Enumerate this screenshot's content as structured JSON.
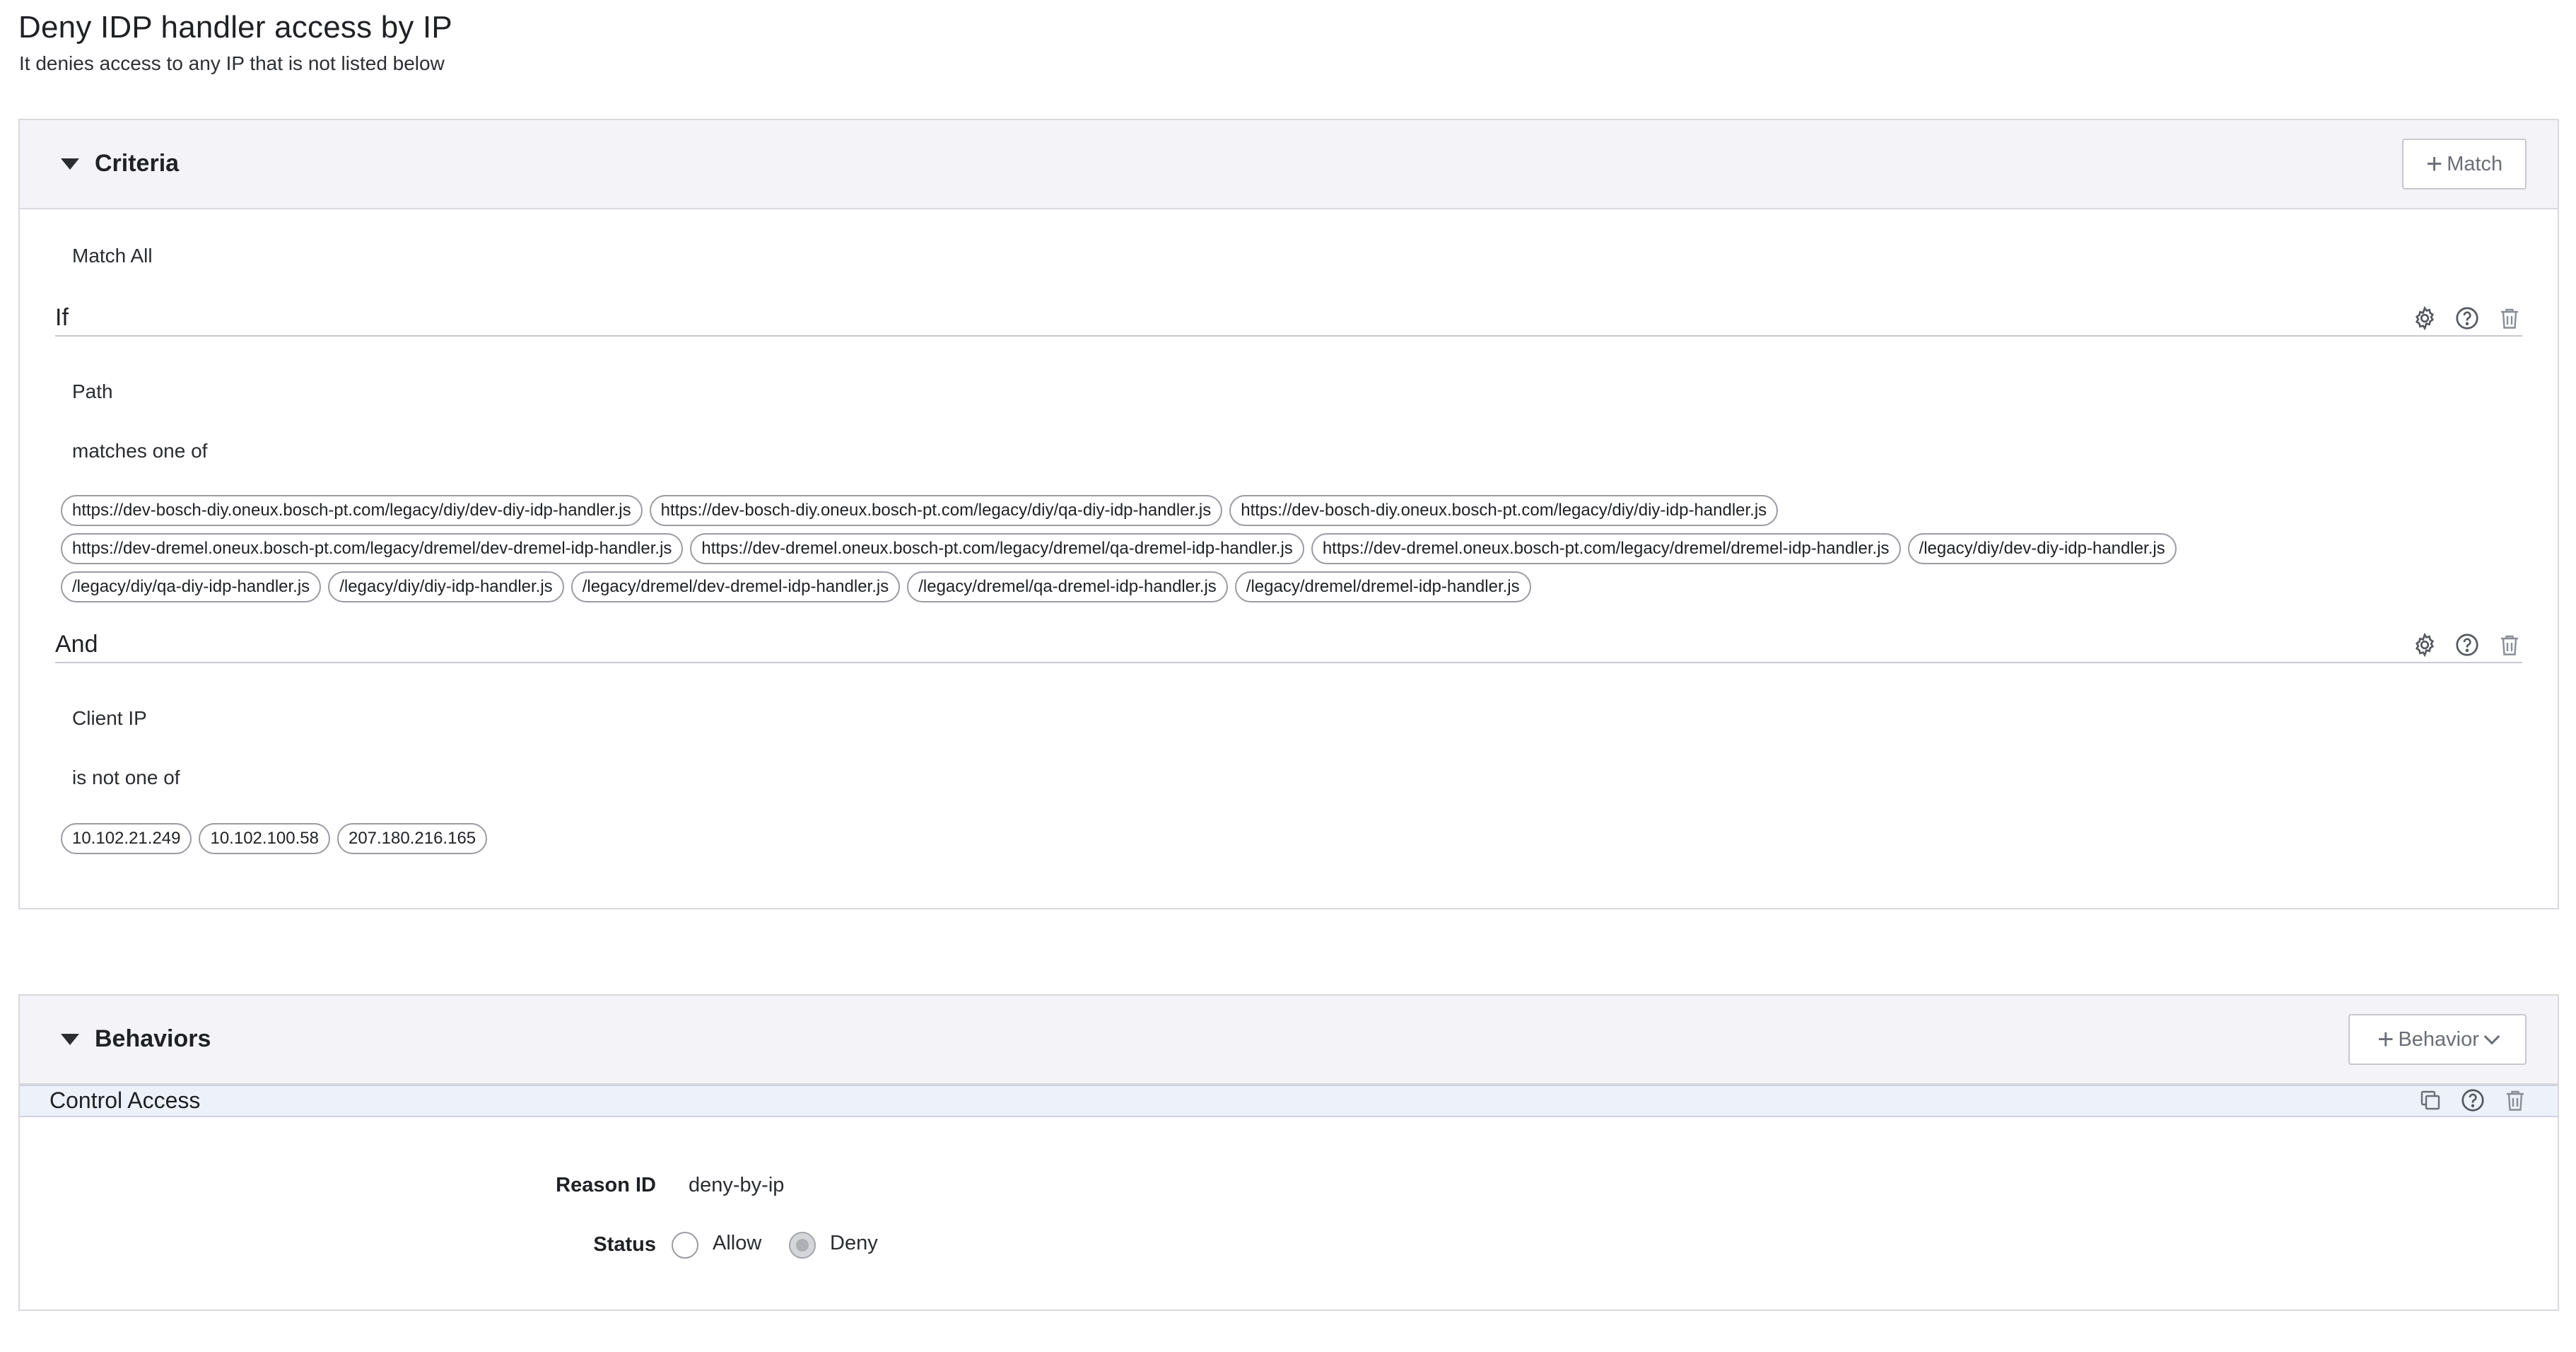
{
  "page": {
    "title": "Deny IDP handler access by IP",
    "subtitle": "It denies access to any IP that is not listed below"
  },
  "criteria": {
    "title": "Criteria",
    "add_button": "Match",
    "match_mode": "Match All",
    "conditions": [
      {
        "connector": "If",
        "field": "Path",
        "operator": "matches one of",
        "values": [
          "https://dev-bosch-diy.oneux.bosch-pt.com/legacy/diy/dev-diy-idp-handler.js",
          "https://dev-bosch-diy.oneux.bosch-pt.com/legacy/diy/qa-diy-idp-handler.js",
          "https://dev-bosch-diy.oneux.bosch-pt.com/legacy/diy/diy-idp-handler.js",
          "https://dev-dremel.oneux.bosch-pt.com/legacy/dremel/dev-dremel-idp-handler.js",
          "https://dev-dremel.oneux.bosch-pt.com/legacy/dremel/qa-dremel-idp-handler.js",
          "https://dev-dremel.oneux.bosch-pt.com/legacy/dremel/dremel-idp-handler.js",
          "/legacy/diy/dev-diy-idp-handler.js",
          "/legacy/diy/qa-diy-idp-handler.js",
          "/legacy/diy/diy-idp-handler.js",
          "/legacy/dremel/dev-dremel-idp-handler.js",
          "/legacy/dremel/qa-dremel-idp-handler.js",
          "/legacy/dremel/dremel-idp-handler.js"
        ]
      },
      {
        "connector": "And",
        "field": "Client IP",
        "operator": "is not one of",
        "values": [
          "10.102.21.249",
          "10.102.100.58",
          "207.180.216.165"
        ]
      }
    ]
  },
  "behaviors": {
    "title": "Behaviors",
    "add_button": "Behavior",
    "items": [
      {
        "name": "Control Access",
        "reason_label": "Reason ID",
        "reason_value": "deny-by-ip",
        "status_label": "Status",
        "options": [
          {
            "label": "Allow",
            "selected": false
          },
          {
            "label": "Deny",
            "selected": true
          }
        ]
      }
    ]
  },
  "icons": {
    "settings": "gear-icon",
    "help": "help-circle-icon",
    "delete": "trash-icon",
    "duplicate": "copy-icon"
  }
}
